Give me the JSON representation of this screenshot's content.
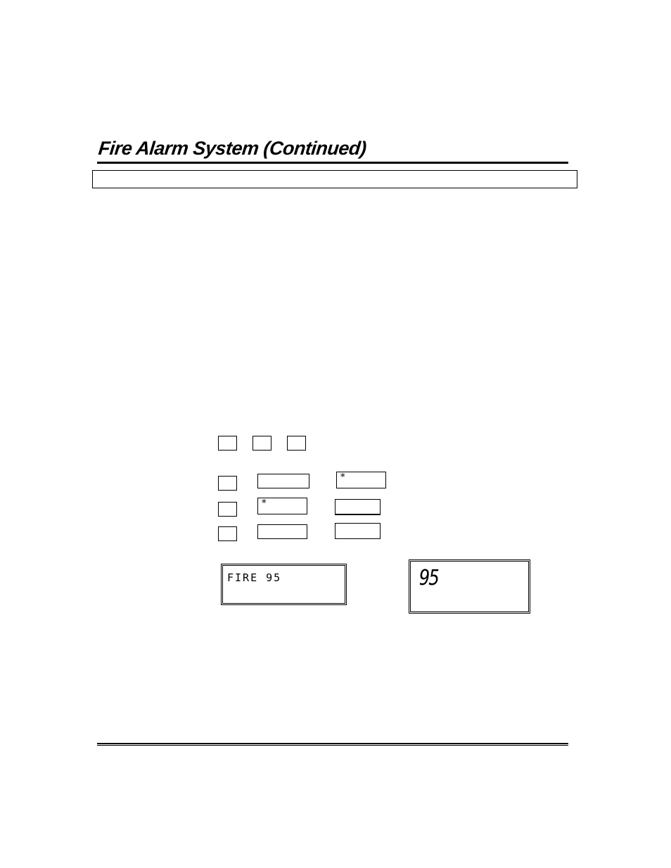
{
  "header": {
    "title": "Fire Alarm System (Continued)"
  },
  "keys": {
    "top_row": [
      "",
      "",
      ""
    ],
    "rows": [
      {
        "key": "",
        "entry1": "",
        "entry2": "*"
      },
      {
        "key": "",
        "entry1": "*",
        "entry2": ""
      },
      {
        "key": "",
        "entry1": "",
        "entry2": ""
      }
    ]
  },
  "displays": {
    "alpha_display_text": "FIRE 95",
    "fixed_word_display_text": "95"
  }
}
